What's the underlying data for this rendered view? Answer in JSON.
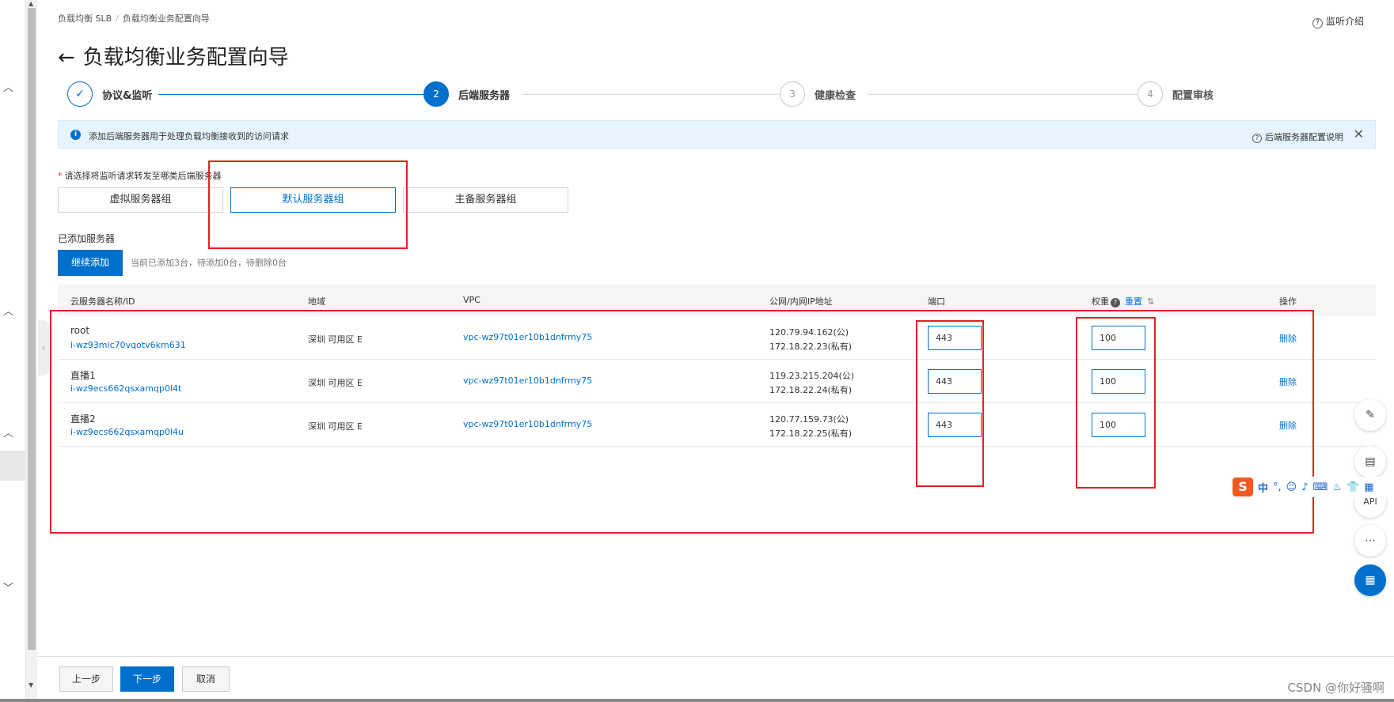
{
  "breadcrumb": {
    "root": "负载均衡 SLB",
    "separator": "/",
    "current": "负载均衡业务配置向导"
  },
  "help_link": "监听介绍",
  "page_title": "负载均衡业务配置向导",
  "back_icon": "←",
  "steps": [
    {
      "marker": "✓",
      "label": "协议&监听",
      "state": "done"
    },
    {
      "marker": "2",
      "label": "后端服务器",
      "state": "active"
    },
    {
      "marker": "3",
      "label": "健康检查",
      "state": "pending"
    },
    {
      "marker": "4",
      "label": "配置审核",
      "state": "pending"
    }
  ],
  "notice": {
    "text": "添加后端服务器用于处理负载均衡接收到的访问请求",
    "help": "后端服务器配置说明",
    "info_icon": "i",
    "close": "✕"
  },
  "server_type": {
    "required_mark": "*",
    "label": "请选择将监听请求转发至哪类后端服务器",
    "options": [
      "虚拟服务器组",
      "默认服务器组",
      "主备服务器组"
    ],
    "selected": "默认服务器组"
  },
  "added_servers": {
    "label": "已添加服务器",
    "add_button": "继续添加",
    "status": "当前已添加3台，待添加0台，待删除0台"
  },
  "table": {
    "columns": {
      "name": "云服务器名称/ID",
      "region": "地域",
      "vpc": "VPC",
      "ip": "公网/内网IP地址",
      "port": "端口",
      "weight": "权重",
      "weight_help": "?",
      "weight_reset": "重置",
      "sort_icon": "⇅",
      "action": "操作"
    },
    "rows": [
      {
        "name": "root",
        "id": "i-wz93mic70vqotv6km631",
        "zone": "深圳 可用区 E",
        "vpc": "vpc-wz97t01er10b1dnfrmy75",
        "public_ip": "120.79.94.162(公)",
        "private_ip": "172.18.22.23(私有)",
        "port": "443",
        "weight": "100",
        "action": "删除"
      },
      {
        "name": "直播1",
        "id": "i-wz9ecs662qsxamqp0l4t",
        "zone": "深圳 可用区 E",
        "vpc": "vpc-wz97t01er10b1dnfrmy75",
        "public_ip": "119.23.215.204(公)",
        "private_ip": "172.18.22.24(私有)",
        "port": "443",
        "weight": "100",
        "action": "删除"
      },
      {
        "name": "直播2",
        "id": "i-wz9ecs662qsxamqp0l4u",
        "zone": "深圳 可用区 E",
        "vpc": "vpc-wz97t01er10b1dnfrmy75",
        "public_ip": "120.77.159.73(公)",
        "private_ip": "172.18.22.25(私有)",
        "port": "443",
        "weight": "100",
        "action": "删除"
      }
    ]
  },
  "float_tools": {
    "edit": "✎",
    "doc": "▤",
    "api": "API",
    "chat": "⋯",
    "apps": "▦"
  },
  "ime_bar": {
    "logo": "S",
    "lang": "中",
    "items": [
      "°,",
      "☺",
      "♪",
      "⌨",
      "♨",
      "👕",
      "▦"
    ]
  },
  "footer": {
    "prev": "上一步",
    "next": "下一步",
    "cancel": "取消"
  },
  "watermark": "CSDN @你好骚啊",
  "colors": {
    "primary": "#0070cc",
    "annotation_red": "#e52222",
    "notice_bg": "#e7f4ff"
  }
}
